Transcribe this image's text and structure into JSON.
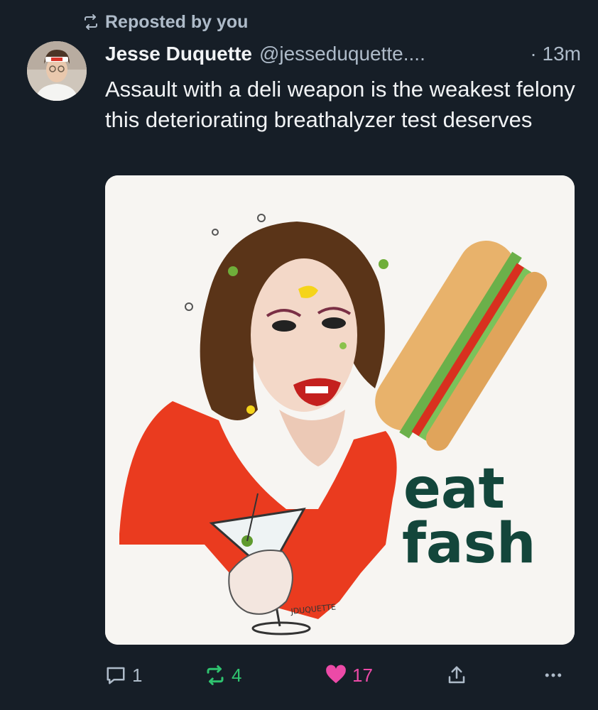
{
  "repost_banner": {
    "text": "Reposted by you",
    "icon": "repost-icon"
  },
  "post": {
    "author_name": "Jesse Duquette",
    "handle": "@jesseduquette....",
    "timestamp": "· 13m",
    "text": "Assault with a deli weapon is the weakest felony this deteriorating breathalyzer test deserves",
    "image": {
      "headline_line1": "eat",
      "headline_line2": "fash",
      "signature": "JDUQUETTE"
    }
  },
  "actions": {
    "reply_count": "1",
    "repost_count": "4",
    "like_count": "17"
  },
  "colors": {
    "background": "#161e27",
    "muted_text": "#aebbc9",
    "repost_active": "#2fc36f",
    "like_active": "#ec4aa7",
    "headline_green": "#13463b"
  }
}
